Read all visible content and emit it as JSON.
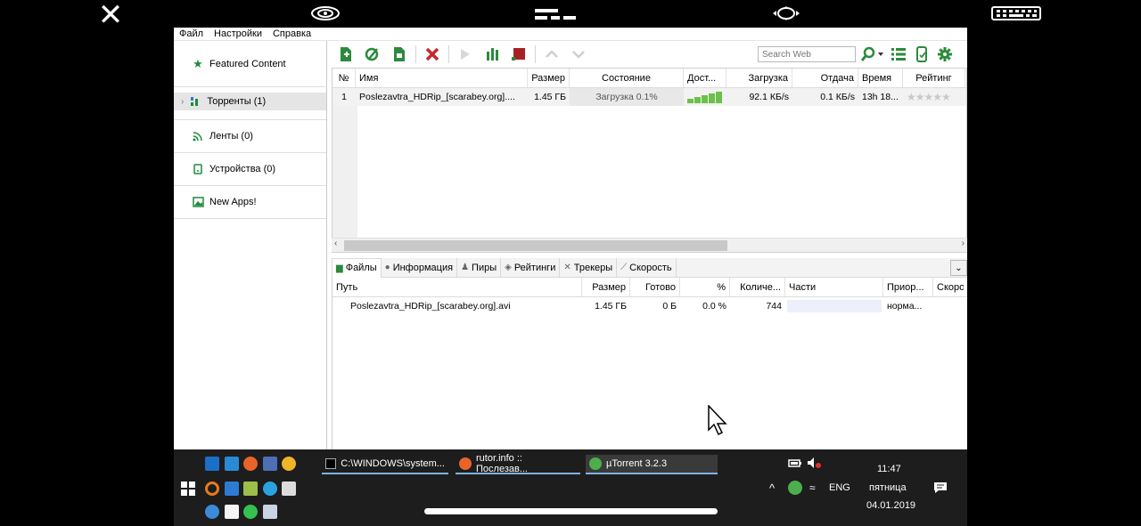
{
  "menubar": {
    "items": [
      "Файл",
      "Настройки",
      "Справка"
    ]
  },
  "sidebar": {
    "items": [
      {
        "label": "Featured Content",
        "icon": "star-icon"
      },
      {
        "label": "Торренты (1)",
        "icon": "torrents-icon"
      },
      {
        "label": "Ленты (0)",
        "icon": "rss-feed-icon"
      },
      {
        "label": "Устройства (0)",
        "icon": "device-icon"
      },
      {
        "label": "New Apps!",
        "icon": "apps-icon"
      }
    ]
  },
  "toolbar": {
    "search_placeholder": "Search Web"
  },
  "torrent_table": {
    "headers": [
      "№",
      "Имя",
      "Размер",
      "Состояние",
      "Дост...",
      "Загрузка",
      "Отдача",
      "Время",
      "Рейтинг"
    ],
    "rows": [
      {
        "num": "1",
        "name": "Poslezavtra_HDRip_[scarabey.org]....",
        "size": "1.45 ГБ",
        "status": "Загрузка 0.1%",
        "progress": 0.001,
        "down": "92.1 КБ/s",
        "up": "0.1 КБ/s",
        "time": "13h 18...",
        "rating": "★★★★★"
      }
    ]
  },
  "detail_tabs": [
    "Файлы",
    "Информация",
    "Пиры",
    "Рейтинги",
    "Трекеры",
    "Скорость"
  ],
  "files_table": {
    "headers": [
      "Путь",
      "Размер",
      "Готово",
      "%",
      "Количе...",
      "Части",
      "Приор...",
      "Скоро"
    ],
    "rows": [
      {
        "path": "Poslezavtra_HDRip_[scarabey.org].avi",
        "size": "1.45 ГБ",
        "done": "0 Б",
        "pct": "0.0 %",
        "count": "744",
        "priority": "норма..."
      }
    ]
  },
  "taskbar": {
    "tasks": [
      {
        "label": "C:\\WINDOWS\\system...",
        "icon": "cmd-icon"
      },
      {
        "label": "rutor.info :: Послезав...",
        "icon": "firefox-icon"
      },
      {
        "label": "µTorrent 3.2.3",
        "icon": "utorrent-icon"
      }
    ],
    "language": "ENG",
    "time": "11:47",
    "day": "пятница",
    "date": "04.01.2019"
  },
  "colors": {
    "accent_green": "#1e8a3a",
    "health_green": "#6cc04a",
    "stop_red": "#c8262b",
    "taskbar": "#1d1d1d"
  }
}
